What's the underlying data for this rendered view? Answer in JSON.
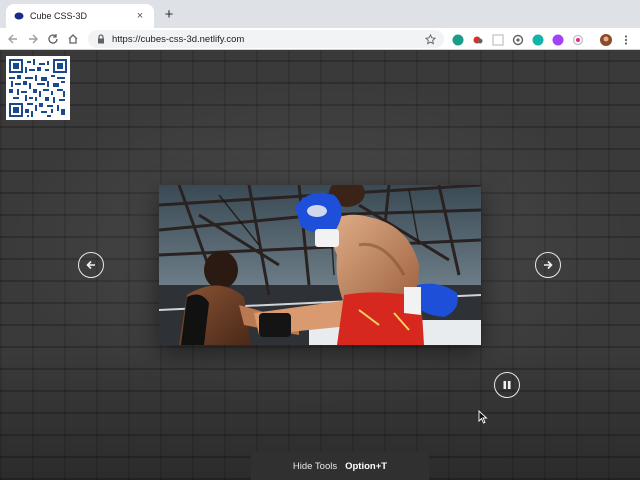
{
  "browser": {
    "tab_title": "Cube CSS-3D",
    "tab_close": "×",
    "new_tab": "+",
    "url": "https://cubes-css-3d.netlify.com",
    "extension_colors": [
      "#1a9c8a",
      "#d93025",
      "#9aa0a6",
      "#5f6368",
      "#12b5a5",
      "#a142f4",
      "#e52592",
      "#bdc1c6"
    ]
  },
  "page": {
    "qr_code": "qr-code",
    "image_alt": "kickboxer-photo"
  },
  "tools": {
    "hide_label": "Hide Tools",
    "shortcut": "Option+T"
  }
}
